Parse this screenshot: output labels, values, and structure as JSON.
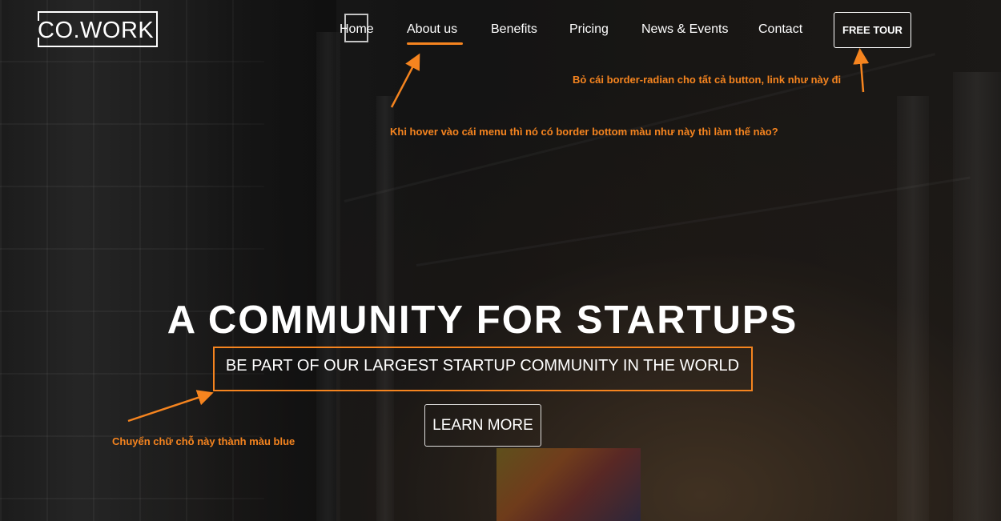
{
  "brand": {
    "logo_text": "CO.WORK"
  },
  "nav": {
    "items": [
      {
        "label": "Home"
      },
      {
        "label": "About us"
      },
      {
        "label": "Benefits"
      },
      {
        "label": "Pricing"
      },
      {
        "label": "News & Events"
      },
      {
        "label": "Contact"
      }
    ],
    "cta_label": "FREE TOUR"
  },
  "hero": {
    "headline": "A COMMUNITY FOR STARTUPS",
    "subheadline": "BE PART OF OUR LARGEST STARTUP COMMUNITY IN THE WORLD",
    "button_label": "LEARN MORE"
  },
  "annotations": {
    "border_radius_note": "Bỏ cái border-radian cho tất cả button, link như này đi",
    "hover_note": "Khi hover vào cái menu thì nó có border bottom màu như này thì làm thế nào?",
    "color_note": "Chuyển chữ chỗ này thành màu blue"
  },
  "colors": {
    "accent": "#f5841f",
    "text": "#ffffff",
    "background": "#1c1c1c"
  }
}
